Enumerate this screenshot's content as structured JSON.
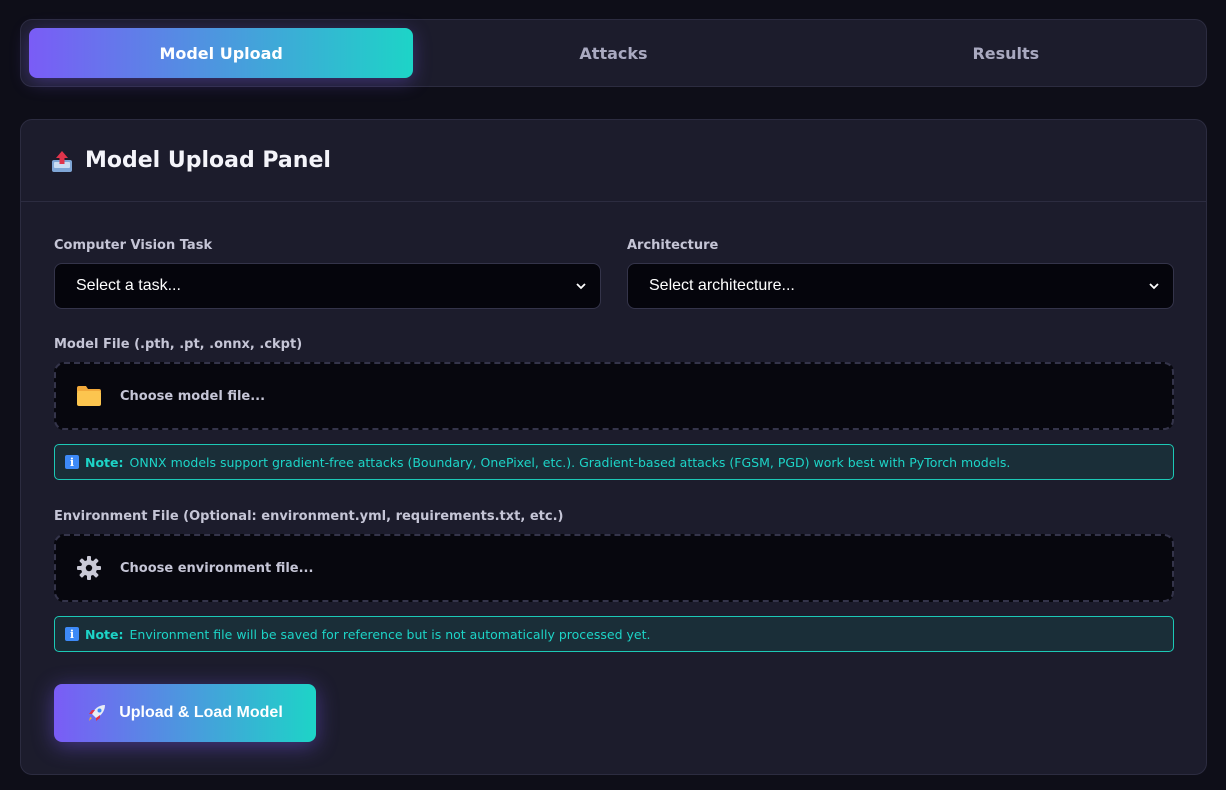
{
  "tabs": [
    {
      "label": "Model Upload",
      "active": true
    },
    {
      "label": "Attacks",
      "active": false
    },
    {
      "label": "Results",
      "active": false
    }
  ],
  "panel": {
    "title": "Model Upload Panel",
    "icon": "outbox-tray-icon",
    "task": {
      "label": "Computer Vision Task",
      "selected": "Select a task..."
    },
    "architecture": {
      "label": "Architecture",
      "selected": "Select architecture..."
    },
    "model_file": {
      "label": "Model File (.pth, .pt, .onnx, .ckpt)",
      "placeholder": "Choose model file...",
      "icon": "folder-icon"
    },
    "model_note": {
      "prefix": "Note:",
      "text": "ONNX models support gradient-free attacks (Boundary, OnePixel, etc.). Gradient-based attacks (FGSM, PGD) work best with PyTorch models."
    },
    "env_file": {
      "label": "Environment File (Optional: environment.yml, requirements.txt, etc.)",
      "placeholder": "Choose environment file...",
      "icon": "gear-icon"
    },
    "env_note": {
      "prefix": "Note:",
      "text": "Environment file will be saved for reference but is not automatically processed yet."
    },
    "submit": {
      "label": "Upload & Load Model",
      "icon": "rocket-icon"
    }
  },
  "colors": {
    "accent_start": "#7a5cf6",
    "accent_end": "#1dd4c7",
    "note_text": "#1dd4c7",
    "background": "#0e0e18"
  }
}
